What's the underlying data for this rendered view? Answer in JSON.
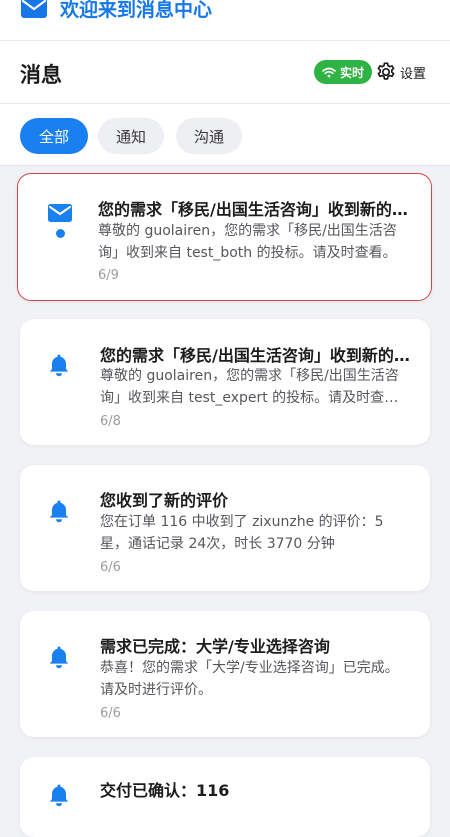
{
  "banner": {
    "title": "欢迎来到消息中心"
  },
  "header": {
    "title": "消息",
    "live_label": "实时",
    "settings_label": "设置"
  },
  "tabs": [
    {
      "label": "全部",
      "active": true
    },
    {
      "label": "通知",
      "active": false
    },
    {
      "label": "沟通",
      "active": false
    }
  ],
  "messages": [
    {
      "icon": "envelope-icon",
      "unread": true,
      "title": "您的需求「移民/出国生活咨询」收到新的投标",
      "body": "尊敬的 guolairen，您的需求「移民/出国生活咨询」收到来自 test_both 的投标。请及时查看。",
      "date": "6/9"
    },
    {
      "icon": "bell-icon",
      "unread": false,
      "title": "您的需求「移民/出国生活咨询」收到新的投标",
      "body": "尊敬的 guolairen，您的需求「移民/出国生活咨询」收到来自 test_expert 的投标。请及时查看。",
      "date": "6/8"
    },
    {
      "icon": "bell-icon",
      "unread": false,
      "title": "您收到了新的评价",
      "body": "您在订单 116 中收到了 zixunzhe 的评价：5星，通话记录 24次，时长 3770 分钟",
      "date": "6/6"
    },
    {
      "icon": "bell-icon",
      "unread": false,
      "title": "需求已完成：大学/专业选择咨询",
      "body": "恭喜！您的需求「大学/专业选择咨询」已完成。请及时进行评价。",
      "date": "6/6"
    },
    {
      "icon": "bell-icon",
      "unread": false,
      "title": "交付已确认：116",
      "body": "",
      "date": ""
    }
  ],
  "colors": {
    "accent": "#1a80f0",
    "live": "#2fb344",
    "selected_border": "#d64545"
  }
}
